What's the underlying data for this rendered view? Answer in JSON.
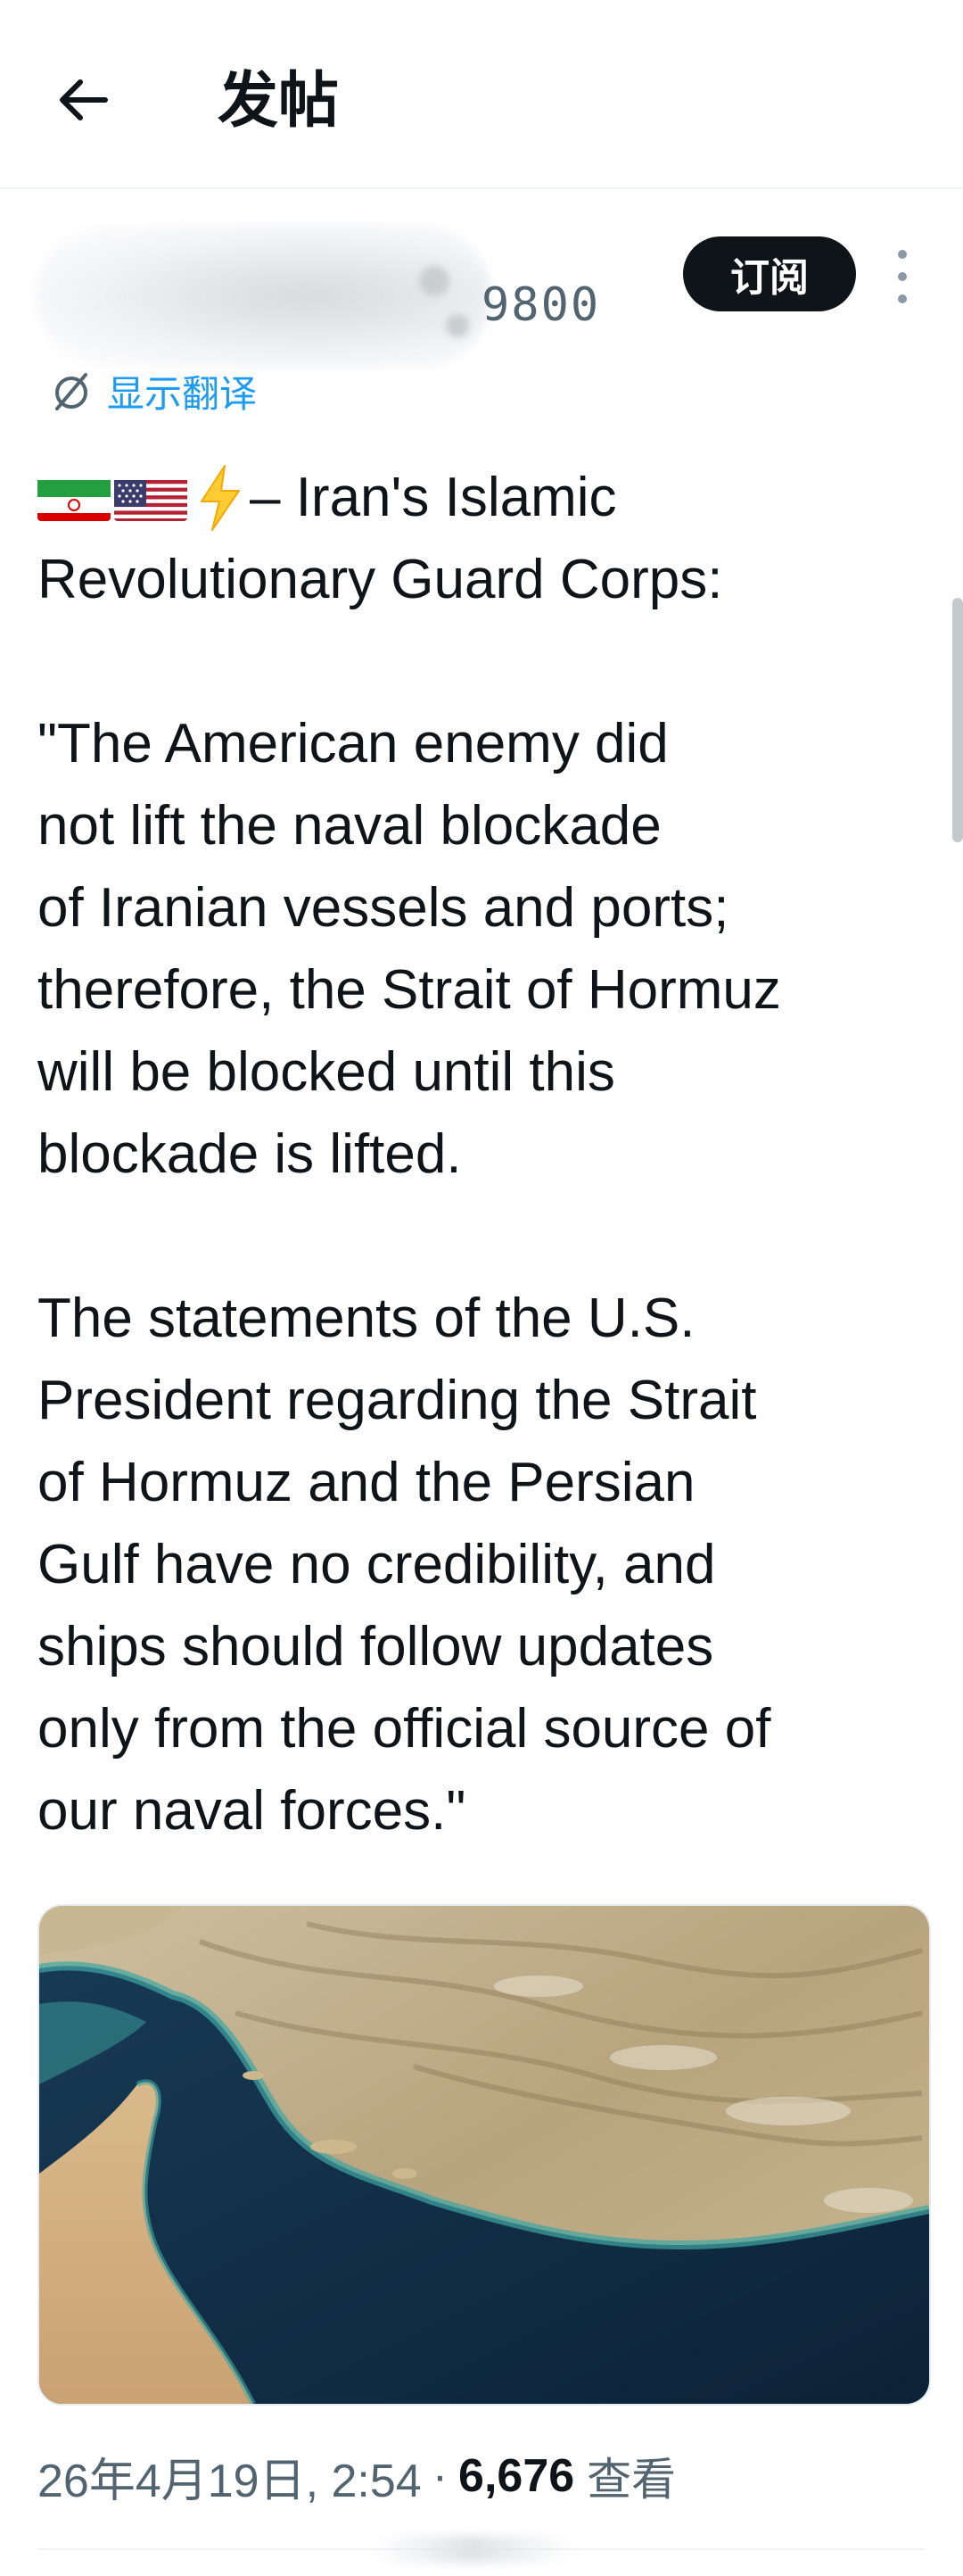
{
  "header": {
    "back_icon": "arrow-left-icon",
    "title": "发帖"
  },
  "author": {
    "handle_visible_tail": "9800",
    "subscribe_label": "订阅",
    "more_icon": "more-vertical-icon",
    "translate_icon": "translate-slash-icon",
    "translate_label": "显示翻译"
  },
  "post": {
    "emoji": [
      "iran-flag-icon",
      "us-flag-icon",
      "lightning-icon"
    ],
    "lines": [
      "– Iran's Islamic",
      "Revolutionary Guard Corps:",
      "",
      "\"The American enemy did",
      "not lift the naval blockade",
      "of Iranian vessels and ports;",
      "therefore, the Strait of Hormuz",
      "will be blocked until this",
      "blockade is lifted.",
      "",
      "The statements of the U.S.",
      "President regarding the Strait",
      "of Hormuz and the Persian",
      "Gulf have no credibility, and",
      "ships should follow updates",
      "only from the official source of",
      "our naval forces.\""
    ],
    "image_subject": "satellite-image-strait-of-hormuz",
    "date_time": "26年4月19日, 2:54",
    "separator": "·",
    "views_count": "6,676",
    "views_label": "查看"
  },
  "colors": {
    "text": "#0f1419",
    "secondary": "#536471",
    "accent": "#1d9bf0",
    "button_bg": "#0f1419",
    "divider": "#eff3f4"
  }
}
